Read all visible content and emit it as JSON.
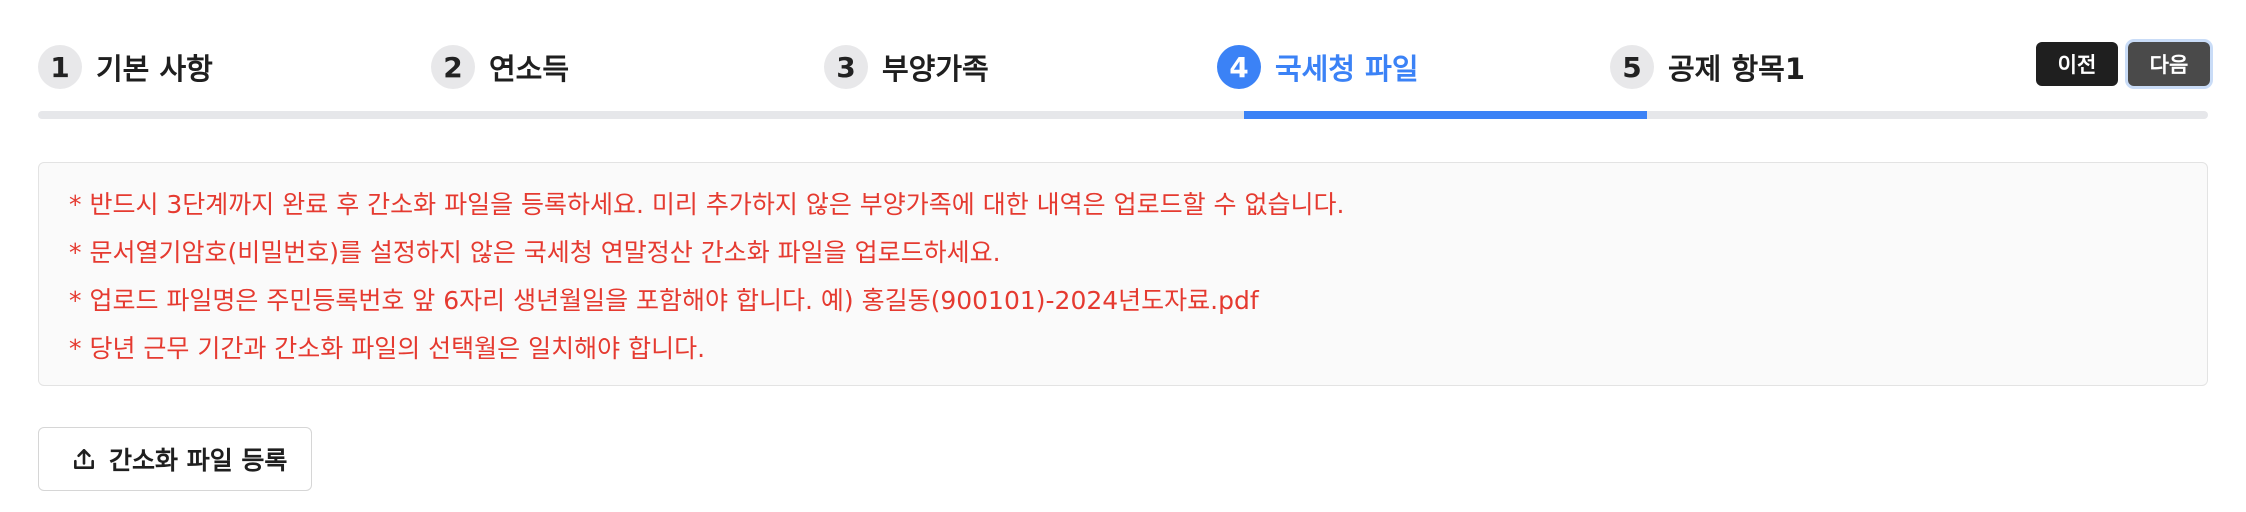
{
  "stepper": {
    "steps": [
      {
        "num": "1",
        "label": "기본 사항"
      },
      {
        "num": "2",
        "label": "연소득"
      },
      {
        "num": "3",
        "label": "부양가족"
      },
      {
        "num": "4",
        "label": "국세청 파일"
      },
      {
        "num": "5",
        "label": "공제 항목1"
      }
    ],
    "active_step": "4"
  },
  "nav": {
    "prev_label": "이전",
    "next_label": "다음"
  },
  "notice": {
    "lines": [
      "* 반드시 3단계까지 완료 후 간소화 파일을 등록하세요. 미리 추가하지 않은 부양가족에 대한 내역은 업로드할 수 없습니다.",
      "* 문서열기암호(비밀번호)를 설정하지 않은 국세청 연말정산 간소화 파일을 업로드하세요.",
      "* 업로드 파일명은 주민등록번호 앞 6자리 생년월일을 포함해야 합니다. 예) 홍길동(900101)-2024년도자료.pdf",
      "* 당년 근무 기간과 간소화 파일의 선택월은 일치해야 합니다."
    ]
  },
  "upload": {
    "label": "간소화 파일 등록",
    "icon": "upload-icon"
  },
  "colors": {
    "accent": "#3b82f6",
    "notice_text": "#e53a30",
    "dark_button": "#1f1f1f"
  }
}
